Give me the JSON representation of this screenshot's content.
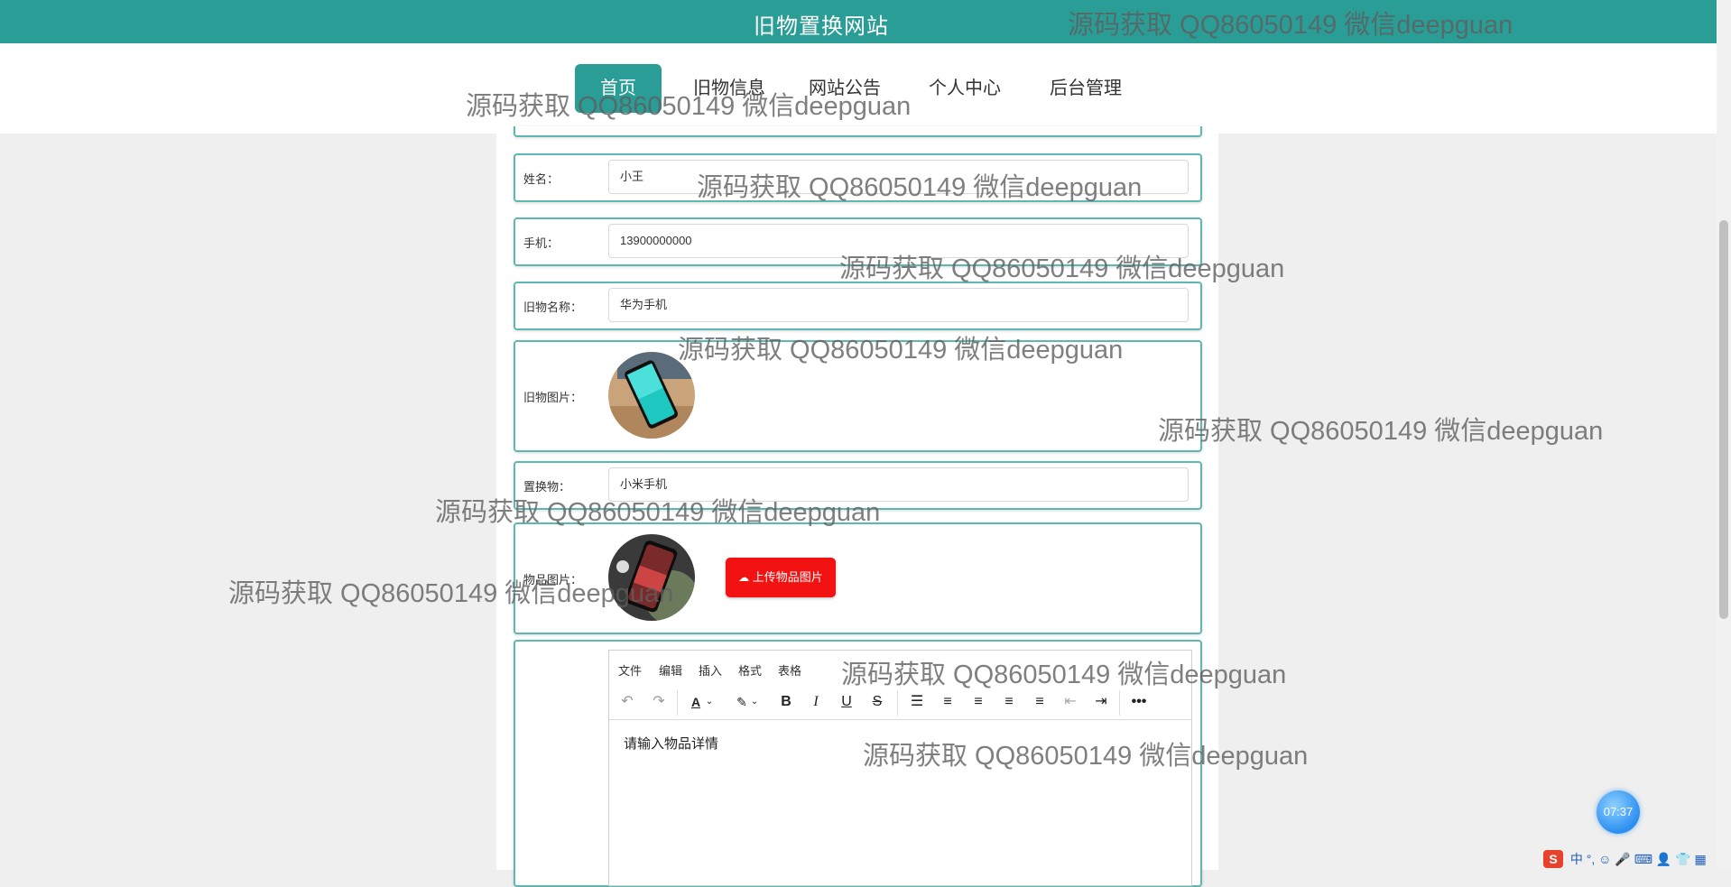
{
  "site": {
    "title": "旧物置换网站"
  },
  "nav": {
    "items": [
      {
        "label": "首页"
      },
      {
        "label": "旧物信息"
      },
      {
        "label": "网站公告"
      },
      {
        "label": "个人中心"
      },
      {
        "label": "后台管理"
      }
    ]
  },
  "form": {
    "name": {
      "label": "姓名：",
      "value": "小王"
    },
    "phone": {
      "label": "手机：",
      "value": "13900000000"
    },
    "item_name": {
      "label": "旧物名称：",
      "value": "华为手机"
    },
    "item_image": {
      "label": "旧物图片："
    },
    "exchange": {
      "label": "置换物：",
      "value": "小米手机"
    },
    "goods_image": {
      "label": "物品图片：",
      "upload_label": "上传物品图片"
    },
    "editor": {
      "menu": [
        "文件",
        "编辑",
        "插入",
        "格式",
        "表格"
      ],
      "placeholder": "请输入物品详情"
    }
  },
  "timer": {
    "value": "07:37"
  },
  "ime": {
    "text": "中 °,"
  },
  "watermark": {
    "text": "源码获取 QQ86050149 微信deepguan"
  },
  "colors": {
    "primary": "#2a9d96",
    "upload": "#f21212",
    "border": "#5fb7b2"
  }
}
